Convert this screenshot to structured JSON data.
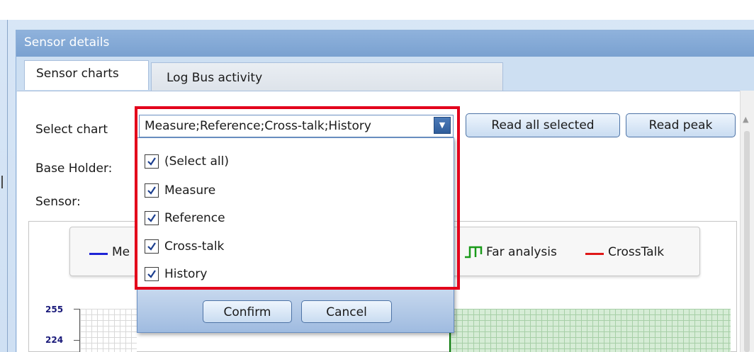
{
  "panel": {
    "title": "Sensor details"
  },
  "tabs": [
    {
      "label": "Sensor charts",
      "active": true
    },
    {
      "label": "Log Bus activity",
      "active": false
    }
  ],
  "form": {
    "select_chart_label": "Select chart",
    "base_holder_label": "Base Holder:",
    "sensor_label": "Sensor:",
    "combo_value": "Measure;Reference;Cross-talk;History",
    "read_all_label": "Read all selected",
    "read_peak_label": "Read peak"
  },
  "dropdown": {
    "items": [
      {
        "label": "(Select all)",
        "checked": true
      },
      {
        "label": "Measure",
        "checked": true
      },
      {
        "label": "Reference",
        "checked": true
      },
      {
        "label": "Cross-talk",
        "checked": true
      },
      {
        "label": "History",
        "checked": true
      }
    ],
    "confirm_label": "Confirm",
    "cancel_label": "Cancel"
  },
  "chart": {
    "legend": {
      "measure_partial": "Me",
      "far_analysis": "Far analysis",
      "crosstalk": "CrossTalk"
    },
    "y_ticks": [
      "255",
      "224"
    ]
  },
  "colors": {
    "measure": "#1e24d6",
    "crosstalk": "#e01818",
    "far_analysis": "#1a9a1a",
    "highlight": "#e3001b"
  }
}
